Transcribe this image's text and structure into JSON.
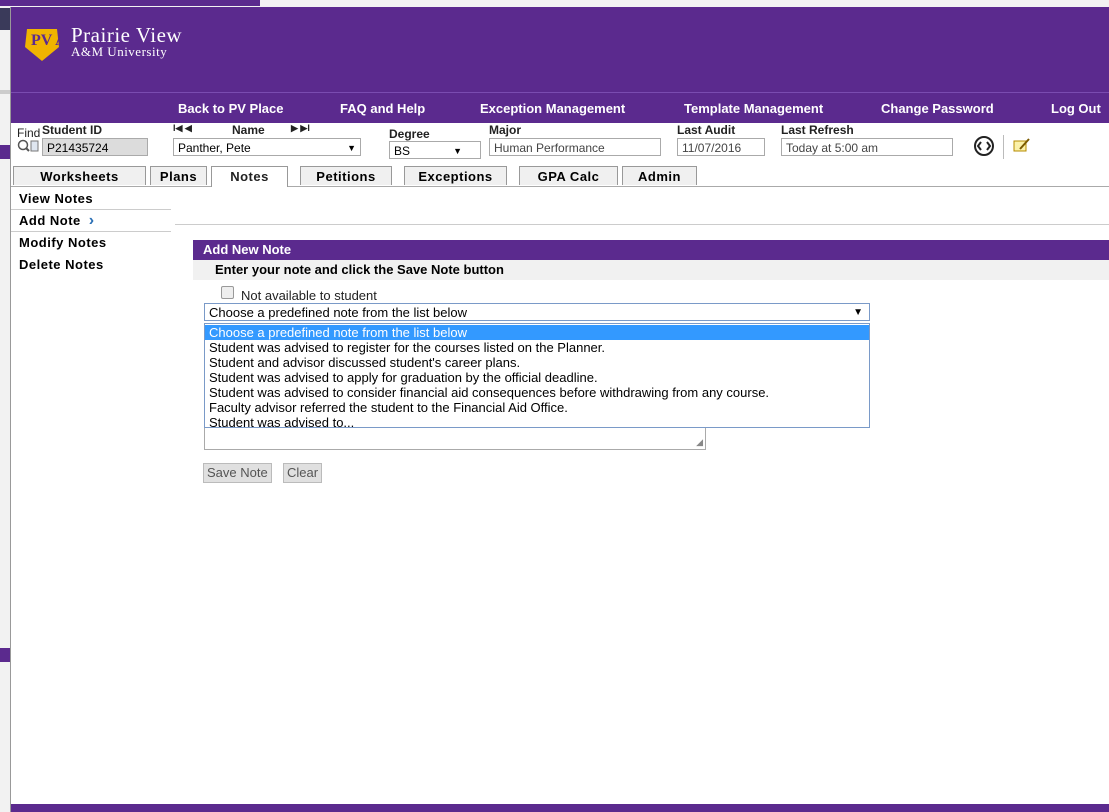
{
  "colors": {
    "brand_purple": "#5b2a8e",
    "selection_blue": "#3399ff",
    "accent_gold": "#f0b400"
  },
  "logo": {
    "line1": "Prairie View",
    "line2": "A&M University",
    "mark_text": "PV AM"
  },
  "nav": {
    "back": "Back to PV Place",
    "faq": "FAQ and Help",
    "exception": "Exception Management",
    "template": "Template Management",
    "password": "Change Password",
    "logout": "Log Out"
  },
  "student": {
    "find_label": "Find",
    "id_label": "Student ID",
    "id_value": "P21435724",
    "name_label": "Name",
    "name_value": "Panther, Pete",
    "degree_label": "Degree",
    "degree_value": "BS",
    "major_label": "Major",
    "major_value": "Human Performance",
    "last_audit_label": "Last Audit",
    "last_audit_value": "11/07/2016",
    "last_refresh_label": "Last Refresh",
    "last_refresh_value": "Today at 5:00 am",
    "first_prev": "I◀ ◀",
    "next_last": "▶ ▶I"
  },
  "tabs": [
    "Worksheets",
    "Plans",
    "Notes",
    "Petitions",
    "Exceptions",
    "GPA Calc",
    "Admin"
  ],
  "menu": [
    "View Notes",
    "Add Note",
    "Modify Notes",
    "Delete Notes"
  ],
  "panel": {
    "title": "Add New Note",
    "instruction": "Enter your note and click the Save Note button",
    "checkbox_label": "Not available to student",
    "select_value": "Choose a predefined note from the list below",
    "options": [
      "Choose a predefined note from the list below",
      "Student was advised to register for the courses listed on the Planner.",
      "Student and advisor discussed student's career plans.",
      "Student was advised to apply for graduation by the official deadline.",
      "Student was advised to consider financial aid consequences before withdrawing from any course.",
      "Faculty advisor referred the student to the Financial Aid Office.",
      "Student was advised to..."
    ],
    "save_label": "Save Note",
    "clear_label": "Clear"
  }
}
